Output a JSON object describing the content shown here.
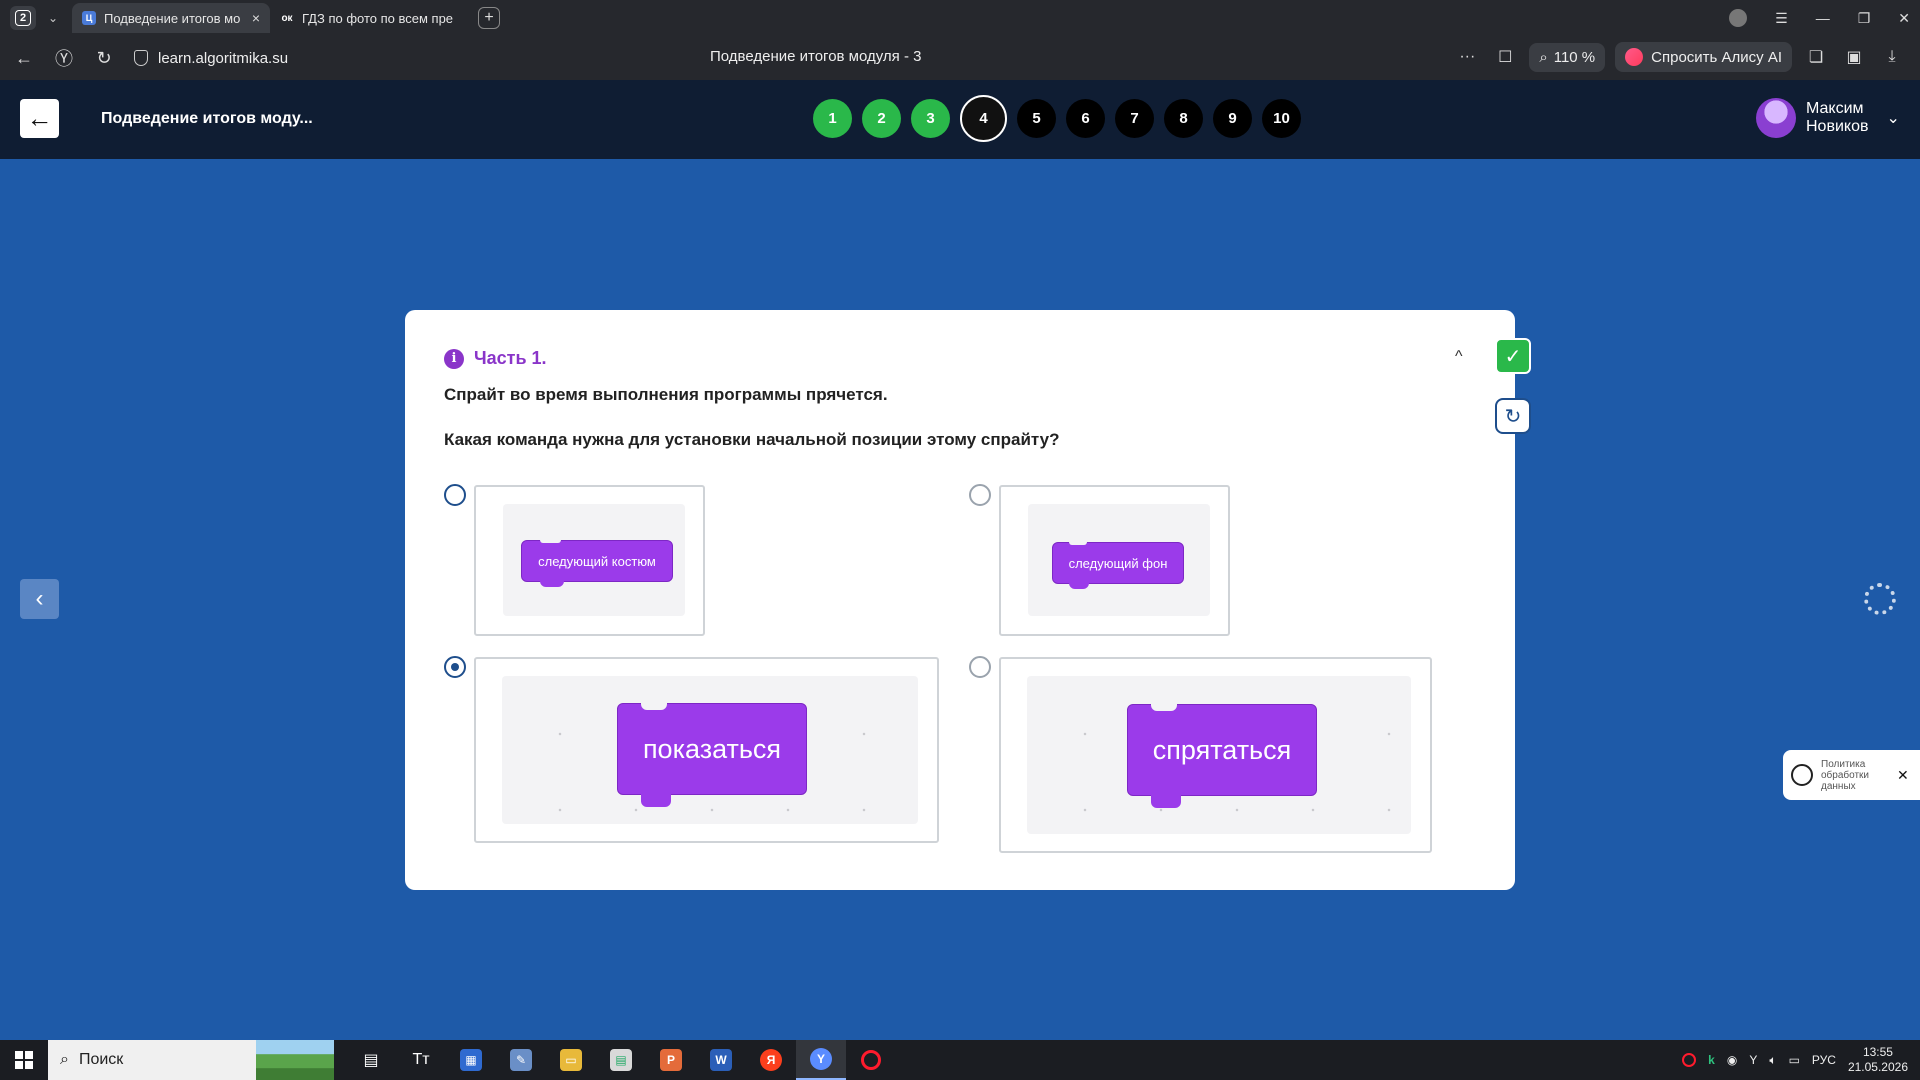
{
  "browser": {
    "tab_count": "2",
    "tabs": [
      {
        "title": "Подведение итогов мо",
        "favicon": "Ц"
      },
      {
        "title": "ГДЗ по фото по всем пре",
        "favicon": "ок"
      }
    ],
    "url": "learn.algoritmika.su",
    "page_title": "Подведение итогов модуля - 3",
    "zoom": "110 %",
    "alice_label": "Спросить Алису AI"
  },
  "header": {
    "module_title": "Подведение итогов моду...",
    "steps": [
      {
        "label": "1",
        "state": "done"
      },
      {
        "label": "2",
        "state": "done"
      },
      {
        "label": "3",
        "state": "done"
      },
      {
        "label": "4",
        "state": "current"
      },
      {
        "label": "5",
        "state": "todo"
      },
      {
        "label": "6",
        "state": "todo"
      },
      {
        "label": "7",
        "state": "todo"
      },
      {
        "label": "8",
        "state": "todo"
      },
      {
        "label": "9",
        "state": "todo"
      },
      {
        "label": "10",
        "state": "todo"
      }
    ],
    "user_first": "Максим",
    "user_last": "Новиков"
  },
  "card": {
    "part_label": "Часть 1.",
    "statement": "Спрайт во время выполнения программы прячется.",
    "question": "Какая команда нужна для установки начальной позиции этому спрайту?",
    "options": [
      {
        "label": "следующий костюм",
        "selected": false
      },
      {
        "label": "следующий фон",
        "selected": false
      },
      {
        "label": "показаться",
        "selected": true
      },
      {
        "label": "спрятаться",
        "selected": false
      }
    ]
  },
  "policy": {
    "text": "Политика обработки данных"
  },
  "taskbar": {
    "search_placeholder": "Поиск",
    "language": "РУС",
    "time": "13:55",
    "date": "21.05.2026"
  },
  "colors": {
    "page_bg": "#1e5aa8",
    "header_bg": "#0f1d33",
    "accent_purple": "#8a35c9",
    "block_purple": "#9b3bea",
    "done_green": "#2ab84a"
  }
}
